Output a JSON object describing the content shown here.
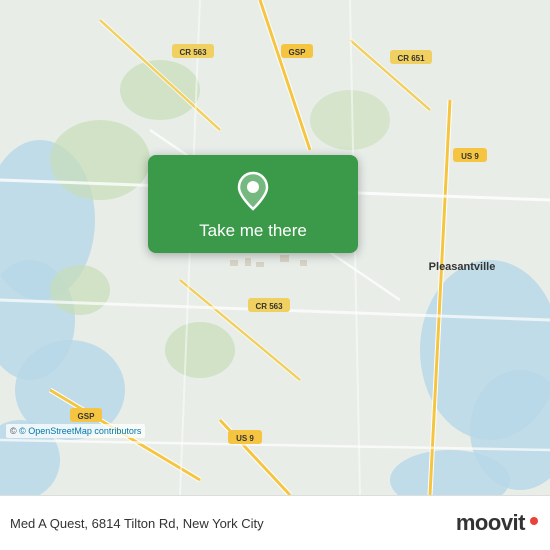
{
  "map": {
    "attribution": "© OpenStreetMap contributors"
  },
  "overlay": {
    "button_label": "Take me there",
    "pin_icon": "location-pin"
  },
  "bottom_bar": {
    "location_text": "Med A Quest, 6814 Tilton Rd, New York City",
    "brand_name": "moovit"
  }
}
